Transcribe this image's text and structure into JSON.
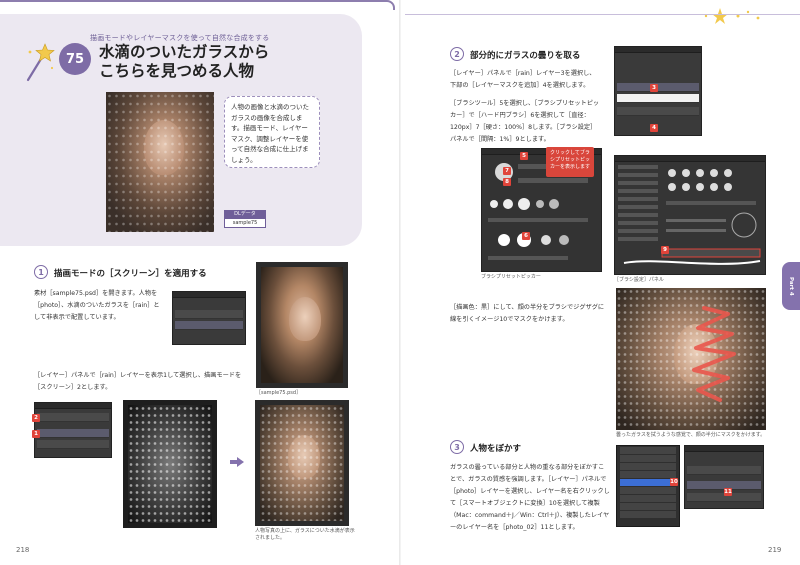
{
  "left_page": {
    "chapter_label": "描画モードやレイヤーマスクを使って自然な合成をする",
    "lesson_number": "75",
    "title_line1": "水滴のついたガラスから",
    "title_line2": "こちらを見つめる人物",
    "intro": "人物の画像と水滴のついたガラスの画像を合成します。描画モード、レイヤーマスク、調整レイヤーを使って自然な合成に仕上げましょう。",
    "dl_badge_label": "DLデータ",
    "dl_badge_file": "sample75",
    "section1": {
      "number": "1",
      "title": "描画モードの［スクリーン］を適用する",
      "text1": "素材［sample75.psd］を開きます。人物を［photo］、水滴のついたガラスを［rain］として非表示で配置しています。",
      "text2": "［レイヤー］パネルで［rain］レイヤーを表示1して選択し、描画モードを［スクリーン］2とします。"
    },
    "photo_caption": "［sample75.psd］",
    "result_caption": "人物写真の上に、ガラスについた水滴が表示されました。",
    "page_number": "218",
    "markers": [
      "1",
      "2"
    ]
  },
  "right_page": {
    "section2": {
      "number": "2",
      "title": "部分的にガラスの曇りを取る",
      "text1": "［レイヤー］パネルで［rain］レイヤー3を選択し、下部の［レイヤーマスクを追加］4を選択します。",
      "text2": "［ブラシツール］5を選択し、［ブラシプリセットピッカー］で［ハード円ブラシ］6を選択して［直径：120px］7［硬さ：100%］8します。［ブラシ設定］パネルで［間隔：1%］9とします。",
      "text3": "［描画色：黒］にして、顔の半分をブラシでジグザグに線を引くイメージ10でマスクをかけます。"
    },
    "callout": "クリックしてブラシプリセットピッカーを表示します",
    "caption_brush_picker": "ブラシプリセットピッカー",
    "caption_brush_settings": "［ブラシ設定］パネル",
    "mask_caption": "曇ったガラスを拭うような感覚で、顔の半分にマスクをかけます。",
    "section3": {
      "number": "3",
      "title": "人物をぼかす",
      "text": "ガラスの曇っている部分と人物の重なる部分をぼかすことで、ガラスの質感を強調します。［レイヤー］パネルで［photo］レイヤーを選択し、レイヤー名を右クリックして［スマートオブジェクトに変換］10を選択して複製（Mac：command＋J／Win：Ctrl＋J）、複製したレイヤーのレイヤー名を［photo_02］11とします。"
    },
    "side_tab": "Part 4",
    "page_number": "219",
    "markers": [
      "3",
      "4",
      "5",
      "6",
      "7",
      "8",
      "9",
      "10",
      "11"
    ]
  },
  "colors": {
    "accent_purple": "#7e6ca6",
    "header_bg": "#ece8f1",
    "marker_red": "#e0443a"
  }
}
